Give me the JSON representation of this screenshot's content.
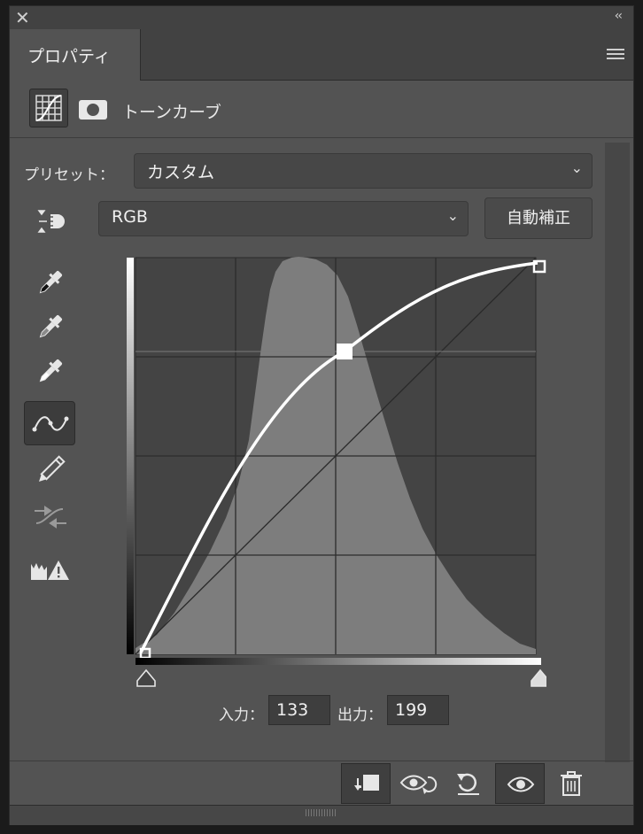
{
  "window": {
    "close_icon": "close-icon",
    "collapse_label": "‹‹"
  },
  "tab": {
    "label": "プロパティ"
  },
  "header": {
    "title": "トーンカーブ"
  },
  "preset": {
    "label": "プリセット：",
    "value": "カスタム"
  },
  "channel": {
    "value": "RGB"
  },
  "auto_button": {
    "label": "自動補正"
  },
  "tools": [
    "targeted-adjustment-icon",
    "black-point-eyedropper-icon",
    "gray-point-eyedropper-icon",
    "white-point-eyedropper-icon",
    "curve-point-tool-icon",
    "pencil-icon",
    "smooth-curve-icon",
    "clipping-warning-icon"
  ],
  "curve": {
    "input_label": "入力：",
    "input_value": "133",
    "output_label": "出力：",
    "output_value": "199",
    "points": [
      [
        0,
        0
      ],
      [
        133,
        199
      ],
      [
        255,
        255
      ]
    ]
  },
  "bottom_buttons": [
    "clip-to-layer-icon",
    "view-previous-icon",
    "reset-icon",
    "visibility-icon",
    "delete-icon"
  ],
  "colors": {
    "panel": "#535353",
    "graph_bg": "#444444",
    "histogram": "#7d7d7d",
    "curve": "#ffffff"
  }
}
